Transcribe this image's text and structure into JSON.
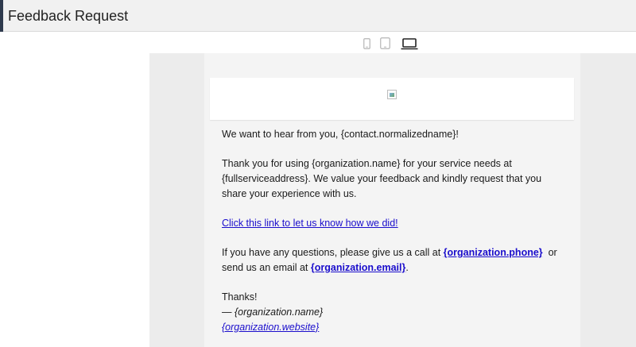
{
  "titlebar": {
    "title": "Feedback Request"
  },
  "device_toggle": {
    "options": [
      "mobile",
      "tablet",
      "desktop"
    ],
    "selected": "desktop"
  },
  "email": {
    "greeting": "We want to hear from you, {contact.normalizedname}!",
    "para1": "Thank you for using {organization.name} for your service needs at {fullserviceaddress}. We value your feedback and kindly request that you share your experience with us.",
    "feedback_link": "Click this link to let us know how we did!",
    "questions_prefix": "If you have any questions, please give us a call at",
    "phone_link": "{organization.phone}",
    "questions_mid": "or send us an email at",
    "email_link": "{organization.email}",
    "questions_suffix": ".",
    "thanks": "Thanks!",
    "signature_name": "— {organization.name}",
    "signature_website": "{organization.website}"
  },
  "colors": {
    "link": "#1a0dcc",
    "titlebar_accent": "#2e3a4d",
    "preview_bg": "#ececec"
  }
}
